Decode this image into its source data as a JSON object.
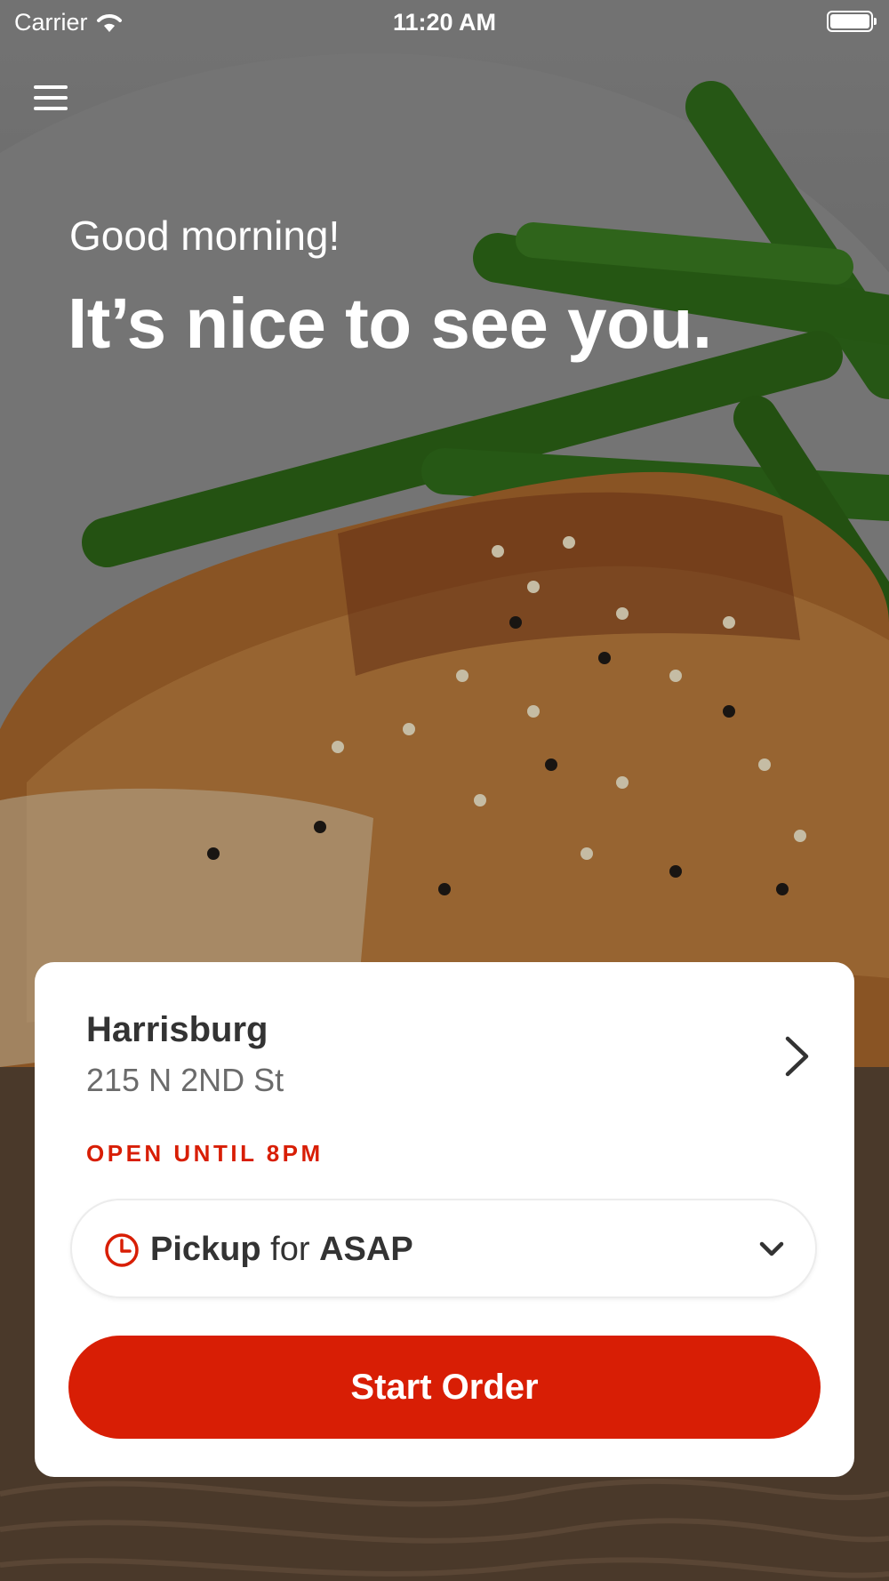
{
  "status_bar": {
    "carrier": "Carrier",
    "time": "11:20 AM",
    "wifi_icon": "wifi-icon",
    "battery_icon": "battery-icon"
  },
  "header": {
    "menu_icon": "hamburger-menu-icon"
  },
  "hero": {
    "greeting": "Good morning!",
    "headline": "It’s nice to see you."
  },
  "location": {
    "name": "Harrisburg",
    "address": "215 N 2ND St",
    "status": "OPEN UNTIL 8PM",
    "chevron_icon": "chevron-right-icon"
  },
  "order_type": {
    "icon": "clock-icon",
    "mode": "Pickup",
    "connector": "for",
    "time": "ASAP",
    "dropdown_icon": "chevron-down-icon"
  },
  "actions": {
    "start_order_label": "Start Order"
  },
  "colors": {
    "accent": "#d81e05",
    "card_bg": "#ffffff",
    "text_dark": "#333333",
    "text_muted": "#6b6b6b"
  }
}
